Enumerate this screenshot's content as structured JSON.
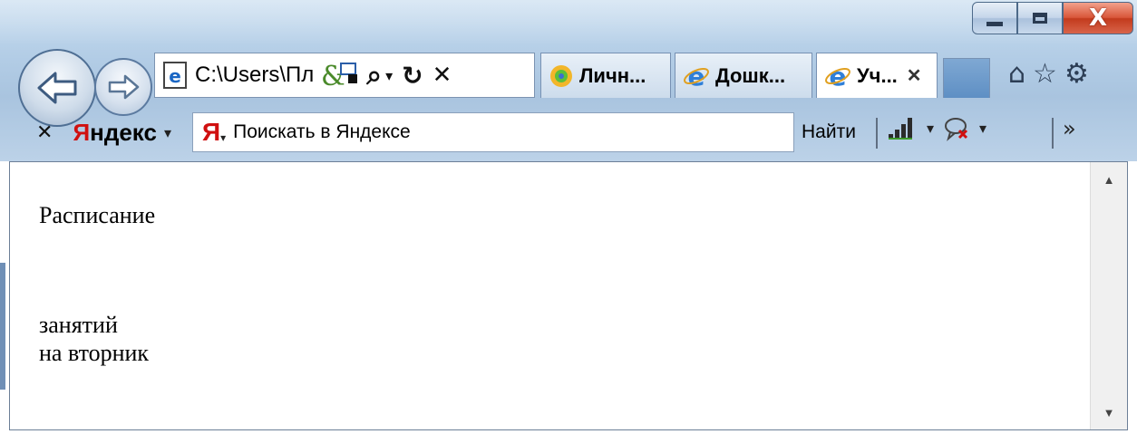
{
  "window": {
    "controls": {
      "minimize_icon": "minimize-icon",
      "maximize_icon": "maximize-icon",
      "close_label": "X"
    }
  },
  "address": {
    "url": "C:\\Users\\Пл",
    "search_glyph": "⌕",
    "dropdown_glyph": "▾",
    "refresh_glyph": "↻",
    "stop_glyph": "✕"
  },
  "tabs": [
    {
      "label": "Личн...",
      "icon": "personal-site-icon"
    },
    {
      "label": "Дошк...",
      "icon": "ie-icon"
    },
    {
      "label": "Уч...",
      "icon": "ie-icon",
      "close": "✕",
      "active": true
    }
  ],
  "toolbar_icons": {
    "home": "⌂",
    "star": "☆",
    "gear": "⚙"
  },
  "yandex": {
    "close": "✕",
    "logo_first": "Я",
    "logo_rest": "ндекс",
    "logo_drop": "▾",
    "search_logo": "Я",
    "search_drop": "▾",
    "placeholder": "Поискать в Яндексе",
    "find_button": "Найти",
    "signal_drop": "▾",
    "mail_drop": "▾",
    "more": "»"
  },
  "page": {
    "line1": "Расписание",
    "line2": "занятий",
    "line3": "на вторник"
  },
  "scrollbar": {
    "up": "▲",
    "down": "▼"
  },
  "colors": {
    "yandex_red": "#d01010",
    "frame_blue": "#b3cde6",
    "close_red": "#c33b1d"
  }
}
